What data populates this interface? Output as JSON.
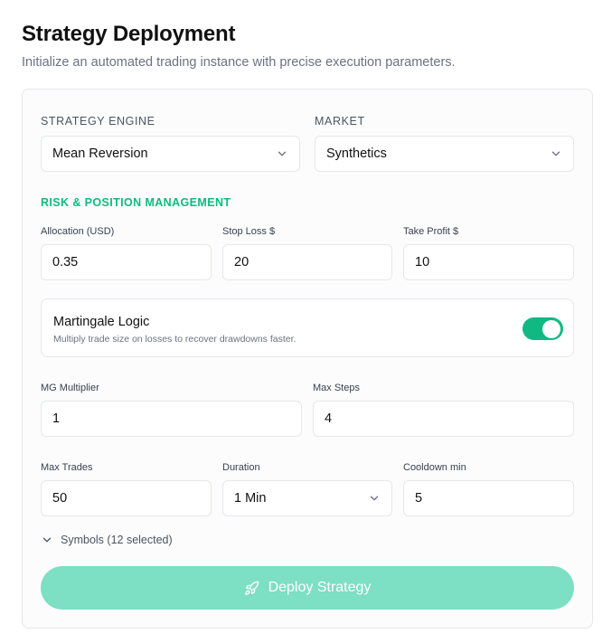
{
  "header": {
    "title": "Strategy Deployment",
    "subtitle": "Initialize an automated trading instance with precise execution parameters."
  },
  "engine": {
    "label": "STRATEGY ENGINE",
    "value": "Mean Reversion"
  },
  "market": {
    "label": "MARKET",
    "value": "Synthetics"
  },
  "risk": {
    "heading": "RISK & POSITION MANAGEMENT",
    "allocation": {
      "label": "Allocation (USD)",
      "value": "0.35"
    },
    "stop_loss": {
      "label": "Stop Loss $",
      "value": "20"
    },
    "take_profit": {
      "label": "Take Profit $",
      "value": "10"
    }
  },
  "martingale": {
    "title": "Martingale Logic",
    "description": "Multiply trade size on losses to recover drawdowns faster.",
    "enabled": true,
    "multiplier": {
      "label": "MG Multiplier",
      "value": "1"
    },
    "max_steps": {
      "label": "Max Steps",
      "value": "4"
    }
  },
  "limits": {
    "max_trades": {
      "label": "Max Trades",
      "value": "50"
    },
    "duration": {
      "label": "Duration",
      "value": "1 Min"
    },
    "cooldown": {
      "label": "Cooldown min",
      "value": "5"
    }
  },
  "symbols": {
    "label": "Symbols (12 selected)"
  },
  "deploy": {
    "label": "Deploy Strategy"
  },
  "colors": {
    "accent": "#10b981",
    "deploy_button": "#7ddfc3",
    "border": "#e5e7eb"
  },
  "icons": {
    "select_chevron": "chevron-down-icon",
    "symbols_chevron": "chevron-down-icon",
    "deploy": "rocket-icon"
  }
}
